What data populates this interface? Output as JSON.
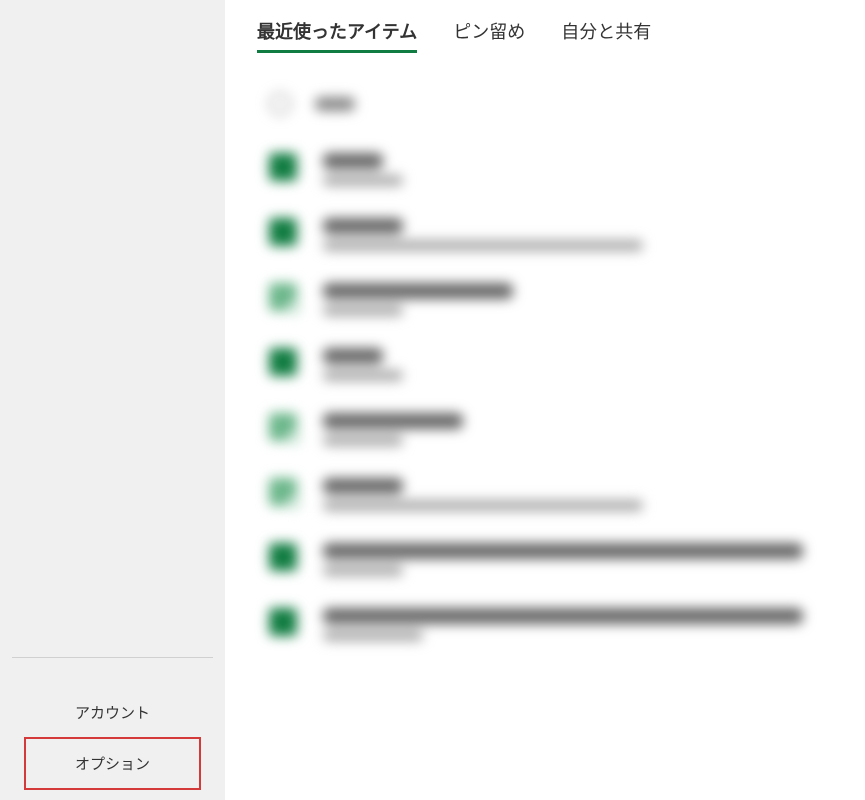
{
  "sidebar": {
    "account_label": "アカウント",
    "options_label": "オプション"
  },
  "tabs": {
    "recent": "最近使ったアイテム",
    "pinned": "ピン留め",
    "shared": "自分と共有"
  }
}
